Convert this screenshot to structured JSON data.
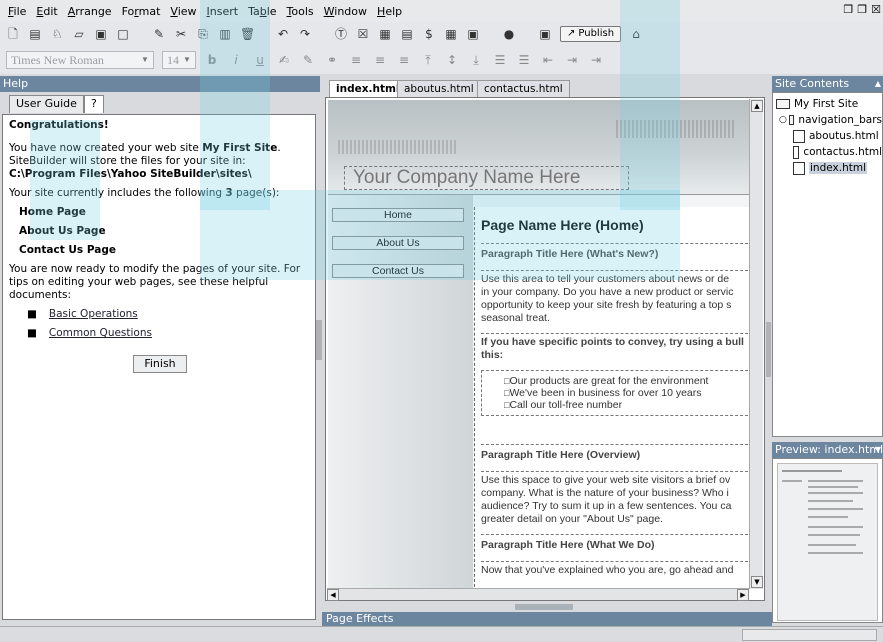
{
  "menu": [
    "File",
    "Edit",
    "Arrange",
    "Format",
    "View",
    "Insert",
    "Table",
    "Tools",
    "Window",
    "Help"
  ],
  "menu_mnemonics": [
    "F",
    "E",
    "A",
    "r",
    "V",
    "I",
    "b",
    "T",
    "W",
    "H"
  ],
  "toolbar": {
    "publish_label": "Publish",
    "font_name": "Times New Roman",
    "font_size": "14"
  },
  "help": {
    "header": "Help",
    "tab_user_guide": "User Guide",
    "tab_question": "?",
    "congrats": "Congratulations!",
    "created_pre": "You have now created your web site ",
    "site_name": "My First Site",
    "created_post": ". SiteBuilder will store the files for your site in: ",
    "store_path": "C:\\Program Files\\Yahoo SiteBuilder\\sites\\",
    "currently_pre": "Your site currently includes the following ",
    "page_count": "3",
    "currently_post": " page(s):",
    "pages": [
      "Home Page",
      "About Us Page",
      "Contact Us Page"
    ],
    "ready_text": "You are now ready to modify the pages of your site. For tips on editing your web pages, see these helpful documents:",
    "links": [
      "Basic Operations",
      "Common Questions"
    ],
    "finish_label": "Finish"
  },
  "editor": {
    "tabs": [
      "index.html",
      "aboutus.html",
      "contactus.html"
    ],
    "company_name": "Your Company Name Here",
    "nav": [
      "Home",
      "About Us",
      "Contact Us"
    ],
    "page_heading": "Page Name Here (Home)",
    "para_title_1": "Paragraph Title Here (What's New?)",
    "para_body_1": [
      "Use this area to tell your customers about news or de",
      "in your company. Do you have a new product or servic",
      "opportunity to keep your site fresh by featuring a top s",
      "seasonal treat."
    ],
    "bullet_intro": [
      "If you have specific points to convey, try using a bull",
      "this:"
    ],
    "bullets": [
      "Our products are great for the environment",
      "We've been in business for over 10 years",
      "Call our toll-free number"
    ],
    "para_title_2": "Paragraph Title Here (Overview)",
    "para_body_2": [
      "Use this space to give your web site visitors a brief ov",
      "company. What is the nature of your business? Who i",
      "audience? Try to sum it up in a few sentences. You ca",
      "greater detail on your \"About Us\" page."
    ],
    "para_title_3": "Paragraph Title Here (What We Do)",
    "para_body_3": [
      "Now that you've explained who you are, go ahead and"
    ],
    "page_effects": "Page Effects"
  },
  "site_contents": {
    "header": "Site Contents",
    "root": "My First Site",
    "items": [
      "navigation_bars",
      "aboutus.html",
      "contactus.html",
      "index.html"
    ]
  },
  "preview": {
    "header": "Preview: index.html"
  }
}
